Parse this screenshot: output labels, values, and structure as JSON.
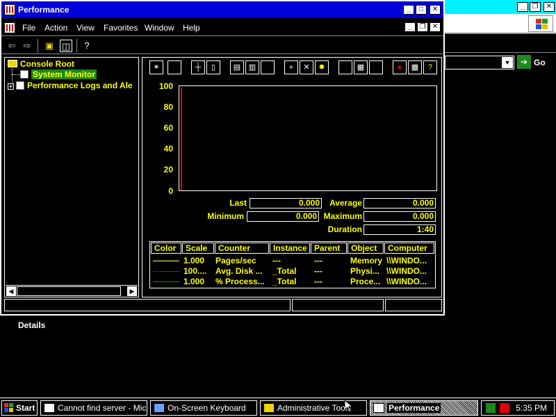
{
  "window": {
    "title": "Performance",
    "menu": [
      "File",
      "Action",
      "View",
      "Favorites",
      "Window",
      "Help"
    ],
    "min_glyph": "_",
    "max_glyph": "□",
    "close_glyph": "✕",
    "restore_glyph": "❐"
  },
  "tree": {
    "root": "Console Root",
    "system_monitor": "System Monitor",
    "perf_logs": "Performance Logs and Ale",
    "expander": "+"
  },
  "graph": {
    "y_ticks": [
      "100",
      "80",
      "60",
      "40",
      "20",
      "0"
    ]
  },
  "stats": {
    "last_label": "Last",
    "last_value": "0.000",
    "average_label": "Average",
    "average_value": "0.000",
    "minimum_label": "Minimum",
    "minimum_value": "0.000",
    "maximum_label": "Maximum",
    "maximum_value": "0.000",
    "duration_label": "Duration",
    "duration_value": "1:40"
  },
  "legend": {
    "headers": [
      "Color",
      "Scale",
      "Counter",
      "Instance",
      "Parent",
      "Object",
      "Computer"
    ],
    "rows": [
      {
        "color": "#ffff66",
        "scale": "1.000",
        "counter": "Pages/sec",
        "instance": "---",
        "parent": "---",
        "object": "Memory",
        "computer": "\\\\WINDO..."
      },
      {
        "color": "#2020ff",
        "scale": "100....",
        "counter": "Avg. Disk ...",
        "instance": "_Total",
        "parent": "---",
        "object": "Physi...",
        "computer": "\\\\WINDO..."
      },
      {
        "color": "#1a8a1a",
        "scale": "1.000",
        "counter": "% Process...",
        "instance": "_Total",
        "parent": "---",
        "object": "Proce...",
        "computer": "\\\\WINDO..."
      }
    ]
  },
  "details_label": "Details",
  "background_window": {
    "go_label": "Go",
    "drop_glyph": "▼"
  },
  "taskbar": {
    "start": "Start",
    "tasks": [
      "Cannot find server - Micr...",
      "On-Screen Keyboard",
      "Administrative Tools",
      "Performance"
    ],
    "clock": "5:35 PM"
  },
  "icons": {
    "back": "back-arrow-icon",
    "forward": "forward-arrow-icon"
  }
}
